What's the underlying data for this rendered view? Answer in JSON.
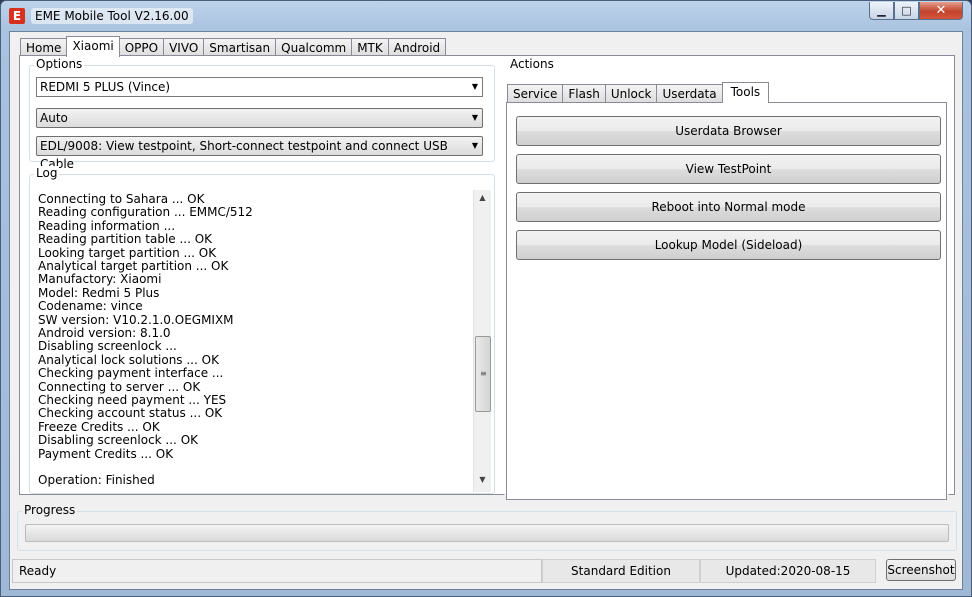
{
  "window": {
    "title": "EME Mobile Tool V2.16.00",
    "caption_buttons": {
      "minimize": "▁",
      "maximize": "□",
      "close": "✕"
    }
  },
  "tabs": [
    {
      "label": "Home",
      "active": false
    },
    {
      "label": "Xiaomi",
      "active": true
    },
    {
      "label": "OPPO",
      "active": false
    },
    {
      "label": "VIVO",
      "active": false
    },
    {
      "label": "Smartisan",
      "active": false
    },
    {
      "label": "Qualcomm",
      "active": false
    },
    {
      "label": "MTK",
      "active": false
    },
    {
      "label": "Android",
      "active": false
    }
  ],
  "options": {
    "label": "Options",
    "model": "REDMI 5 PLUS (Vince)",
    "mode": "Auto",
    "method": "EDL/9008: View testpoint, Short-connect testpoint and connect USB Cable"
  },
  "log": {
    "label": "Log",
    "lines": [
      "Connecting to Sahara ... OK",
      "Reading configuration ... EMMC/512",
      "Reading information ...",
      "Reading partition table ... OK",
      "Looking target partition ... OK",
      "Analytical target partition ... OK",
      "Manufactory: Xiaomi",
      "Model: Redmi 5 Plus",
      "Codename: vince",
      "SW version: V10.2.1.0.OEGMIXM",
      "Android version: 8.1.0",
      "Disabling screenlock ...",
      "Analytical lock solutions ... OK",
      "Checking payment interface ...",
      "Connecting to server ... OK",
      "Checking need payment ... YES",
      "Checking account status ... OK",
      "Freeze Credits ... OK",
      "Disabling screenlock ... OK",
      "Payment Credits ... OK",
      "",
      "Operation: Finished"
    ]
  },
  "actions": {
    "label": "Actions",
    "tabs": [
      {
        "label": "Service",
        "active": false
      },
      {
        "label": "Flash",
        "active": false
      },
      {
        "label": "Unlock",
        "active": false
      },
      {
        "label": "Userdata",
        "active": false
      },
      {
        "label": "Tools",
        "active": true
      }
    ],
    "buttons": [
      "Userdata Browser",
      "View TestPoint",
      "Reboot into Normal mode",
      "Lookup Model (Sideload)"
    ]
  },
  "progress": {
    "label": "Progress",
    "value": 0
  },
  "status": {
    "ready": "Ready",
    "edition": "Standard Edition",
    "updated": "Updated:2020-08-15",
    "screenshot_button": "Screenshot"
  },
  "colors": {
    "close_button": "#c2432c",
    "app_icon": "#d8301f",
    "frame": "#a9c2df"
  },
  "icons": {
    "app": "eme-logo-icon",
    "combo_arrow": "▼",
    "scroll_up": "▲",
    "scroll_down": "▼",
    "grip": "≡"
  }
}
